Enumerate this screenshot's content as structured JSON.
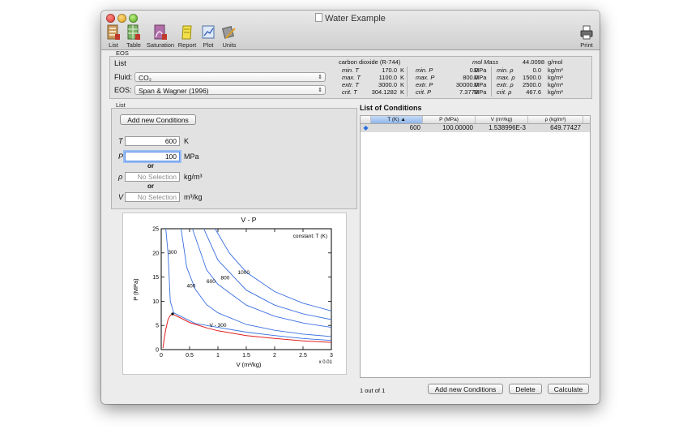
{
  "window": {
    "title": "Water Example"
  },
  "toolbar": {
    "items": [
      {
        "label": "List"
      },
      {
        "label": "Table"
      },
      {
        "label": "Saturation"
      },
      {
        "label": "Report"
      },
      {
        "label": "Plot"
      },
      {
        "label": "Units"
      }
    ],
    "print_label": "Print"
  },
  "eos_group": {
    "section_label": "EOS",
    "panel_title": "List",
    "fluid_label": "Fluid:",
    "fluid_value": "CO₂",
    "eos_label": "EOS:",
    "eos_value": "Span & Wagner (1996)"
  },
  "fluid_info": {
    "name": "carbon dioxide (R-744)",
    "molmass_label": "mol Mass",
    "molmass_value": "44.0098",
    "molmass_unit": "g/mol",
    "rows": [
      {
        "l1": "min. T",
        "v1": "170.0",
        "u1": "K",
        "l2": "min. P",
        "v2": "0.0",
        "u2": "MPa",
        "l3": "min. ρ",
        "v3": "0.0",
        "u3": "kg/m³"
      },
      {
        "l1": "max. T",
        "v1": "1100.0",
        "u1": "K",
        "l2": "max. P",
        "v2": "800.0",
        "u2": "MPa",
        "l3": "max. ρ",
        "v3": "1500.0",
        "u3": "kg/m³"
      },
      {
        "l1": "extr. T",
        "v1": "3000.0",
        "u1": "K",
        "l2": "extr. P",
        "v2": "30000.0",
        "u2": "MPa",
        "l3": "extr. ρ",
        "v3": "2500.0",
        "u3": "kg/m³"
      },
      {
        "l1": "crit. T",
        "v1": "304.1282",
        "u1": "K",
        "l2": "crit. P",
        "v2": "7.3773",
        "u2": "MPa",
        "l3": "crit. ρ",
        "v3": "467.6",
        "u3": "kg/m³"
      }
    ]
  },
  "list_group": {
    "section_label": "List",
    "add_button": "Add new Conditions",
    "t_label": "T",
    "t_value": "600",
    "t_unit": "K",
    "p_label": "P",
    "p_value": "100",
    "p_unit": "MPa",
    "or1": "or",
    "rho_label": "ρ",
    "rho_value": "No Selection",
    "rho_unit": "kg/m³",
    "or2": "or",
    "v_label": "V",
    "v_value": "No Selection",
    "v_unit": "m³/kg"
  },
  "conditions": {
    "title": "List of Conditions",
    "columns": [
      "T (K)",
      "P (MPa)",
      "V (m³/kg)",
      "ρ (kg/m³)"
    ],
    "rows": [
      {
        "T": "600",
        "P": "100.00000",
        "V": "1.538996E-3",
        "rho": "649.77427"
      }
    ],
    "count": "1 out of 1",
    "add_button": "Add new Conditions",
    "delete_button": "Delete",
    "calculate_button": "Calculate"
  },
  "colors": {
    "isotherm": "#3a6fe0",
    "saturation": "#e02020",
    "selection": "#8fb4ea"
  },
  "chart_data": {
    "type": "line",
    "title": "V - P",
    "xlabel": "V (m³/kg)",
    "ylabel": "P (MPa)",
    "x_multiplier_label": "x 0.01",
    "legend_text": "constant: T (K)",
    "xlim": [
      0,
      3
    ],
    "ylim": [
      0,
      25
    ],
    "xticks": [
      "0",
      "0.5",
      "1",
      "1.5",
      "2",
      "2.5",
      "3"
    ],
    "yticks": [
      "0",
      "5",
      "10",
      "15",
      "20",
      "25"
    ],
    "series": [
      {
        "name": "300",
        "x": [
          0.08,
          0.12,
          0.16,
          0.22,
          0.6,
          1.0,
          1.5,
          2.0,
          2.5,
          3.0
        ],
        "y": [
          25,
          20,
          10,
          7.6,
          5.4,
          4.6,
          3.6,
          2.9,
          2.3,
          1.9
        ]
      },
      {
        "name": "400",
        "x": [
          0.35,
          0.45,
          0.6,
          0.8,
          1.0,
          1.5,
          2.0,
          2.5,
          3.0
        ],
        "y": [
          25,
          17,
          12.5,
          9.3,
          7.6,
          5.2,
          4.0,
          3.2,
          2.7
        ]
      },
      {
        "name": "600",
        "x": [
          0.55,
          0.8,
          1.0,
          1.5,
          2.0,
          2.5,
          3.0
        ],
        "y": [
          25,
          16.5,
          13.5,
          9.2,
          6.9,
          5.5,
          4.6
        ]
      },
      {
        "name": "800",
        "x": [
          0.75,
          1.0,
          1.5,
          2.0,
          2.5,
          3.0
        ],
        "y": [
          25,
          18.5,
          12.3,
          9.2,
          7.4,
          6.2
        ]
      },
      {
        "name": "1000",
        "x": [
          0.95,
          1.2,
          1.5,
          2.0,
          2.5,
          3.0
        ],
        "y": [
          25,
          20,
          16,
          12,
          9.6,
          8.0
        ]
      }
    ],
    "saturation": {
      "x": [
        0.03,
        0.05,
        0.08,
        0.12,
        0.16,
        0.2,
        0.22,
        0.3,
        0.5,
        0.8,
        1.0,
        1.5,
        2.0,
        2.5,
        3.0
      ],
      "y": [
        0.3,
        2.0,
        4.2,
        6.2,
        7.1,
        7.35,
        7.2,
        6.8,
        5.6,
        4.5,
        3.9,
        2.9,
        2.3,
        1.8,
        1.5
      ]
    },
    "critical_point": {
      "x": 0.2,
      "y": 7.38
    },
    "annotations": [
      {
        "text": "300",
        "x": 0.12,
        "y": 19.8
      },
      {
        "text": "400",
        "x": 0.45,
        "y": 12.8
      },
      {
        "text": "600",
        "x": 0.8,
        "y": 13.8
      },
      {
        "text": "800",
        "x": 1.05,
        "y": 14.5
      },
      {
        "text": "1000",
        "x": 1.35,
        "y": 15.6
      },
      {
        "text": "V - 300",
        "x": 0.85,
        "y": 4.7
      }
    ]
  }
}
